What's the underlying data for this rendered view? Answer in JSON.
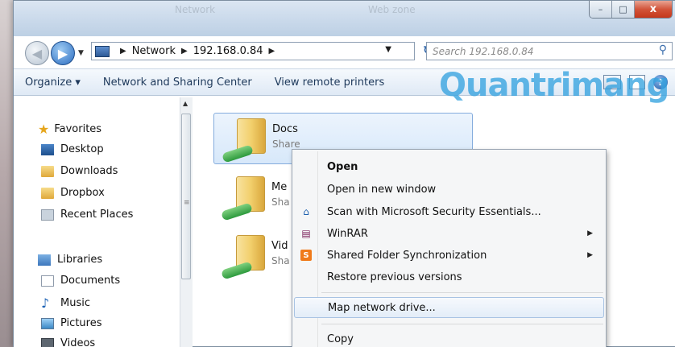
{
  "window": {
    "title_ghost_left": "Network",
    "title_ghost_right": "Web zone",
    "caption": {
      "minimize": "–",
      "maximize": "□",
      "close": "x"
    }
  },
  "address": {
    "crumbs": [
      "Network",
      "192.168.0.84"
    ],
    "search_placeholder": "Search 192.168.0.84"
  },
  "toolbar": {
    "organize": "Organize ▾",
    "network_center": "Network and Sharing Center",
    "remote_printers": "View remote printers",
    "help": "?"
  },
  "watermark": "Quantrimang",
  "nav": {
    "favorites": "Favorites",
    "desktop": "Desktop",
    "downloads": "Downloads",
    "dropbox": "Dropbox",
    "recent": "Recent Places",
    "libraries": "Libraries",
    "documents": "Documents",
    "music": "Music",
    "pictures": "Pictures",
    "videos": "Videos"
  },
  "items": [
    {
      "name": "Docs",
      "sub": "Share"
    },
    {
      "name": "Me",
      "sub": "Sha"
    },
    {
      "name": "Vid",
      "sub": "Sha"
    }
  ],
  "menu": {
    "open": "Open",
    "open_new": "Open in new window",
    "scan": "Scan with Microsoft Security Essentials...",
    "winrar": "WinRAR",
    "shared_sync": "Shared Folder Synchronization",
    "restore": "Restore previous versions",
    "map": "Map network drive...",
    "copy": "Copy"
  },
  "colors": {
    "accent": "#36a3e0",
    "selection": "#d7e8fa",
    "close_button": "#c5371b"
  }
}
